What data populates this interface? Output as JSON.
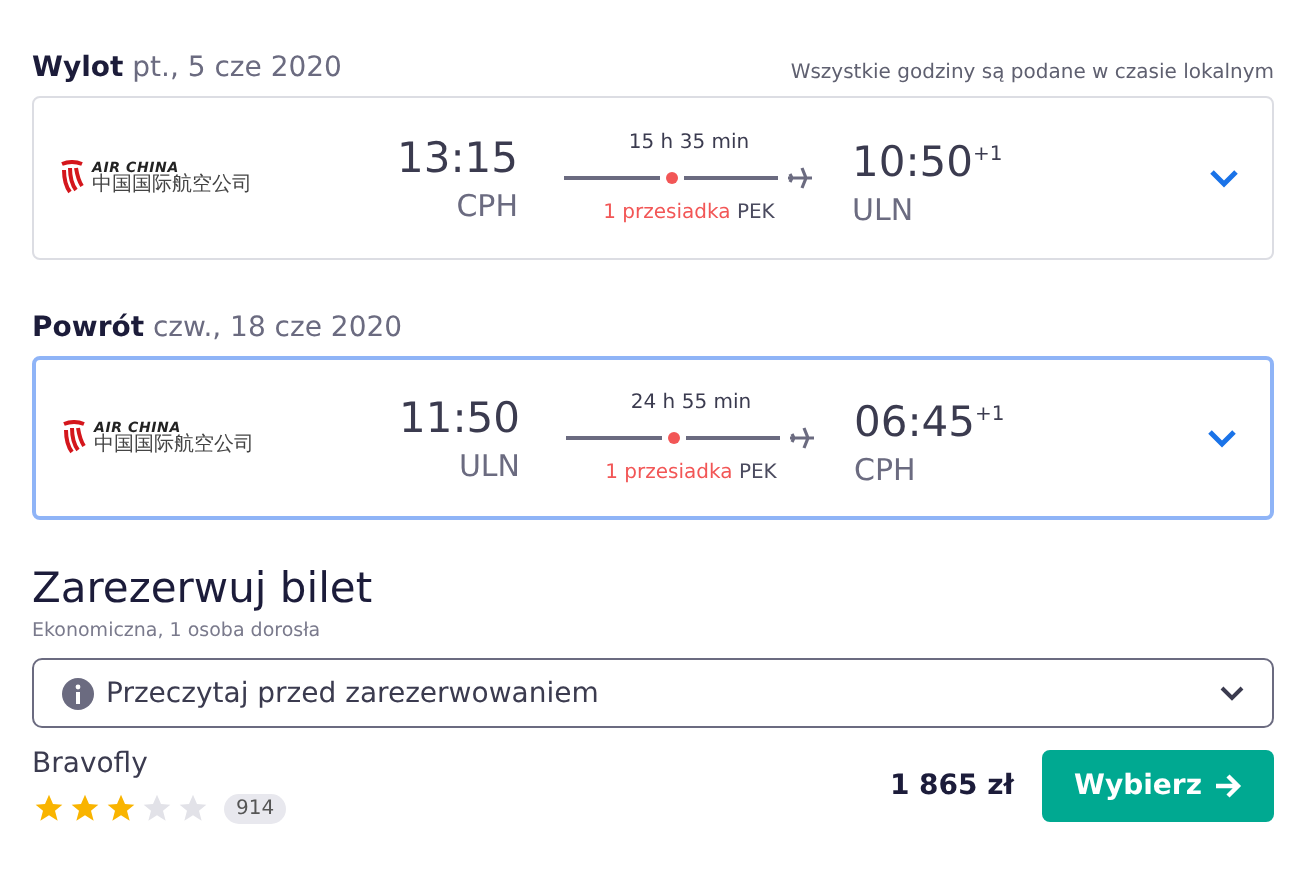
{
  "legs": [
    {
      "label": "Wylot",
      "date": "pt., 5 cze 2020",
      "note": "Wszystkie godziny są podane w czasie lokalnym",
      "selected": false,
      "airline": {
        "name": "AIR CHINA",
        "native": "中国国际航空公司"
      },
      "depart_time": "13:15",
      "depart_code": "CPH",
      "duration": "15 h 35 min",
      "stops": "1 przesiadka",
      "stop_code": "PEK",
      "arrive_time": "10:50",
      "arrive_offset": "+1",
      "arrive_code": "ULN"
    },
    {
      "label": "Powrót",
      "date": "czw., 18 cze 2020",
      "selected": true,
      "airline": {
        "name": "AIR CHINA",
        "native": "中国国际航空公司"
      },
      "depart_time": "11:50",
      "depart_code": "ULN",
      "duration": "24 h 55 min",
      "stops": "1 przesiadka",
      "stop_code": "PEK",
      "arrive_time": "06:45",
      "arrive_offset": "+1",
      "arrive_code": "CPH"
    }
  ],
  "booking": {
    "title": "Zarezerwuj bilet",
    "subtitle": "Ekonomiczna, 1 osoba dorosła",
    "info": "Przeczytaj przed zarezerwowaniem",
    "provider": "Bravofly",
    "stars": 3,
    "reviews": "914",
    "price": "1 865 zł",
    "button": "Wybierz"
  }
}
